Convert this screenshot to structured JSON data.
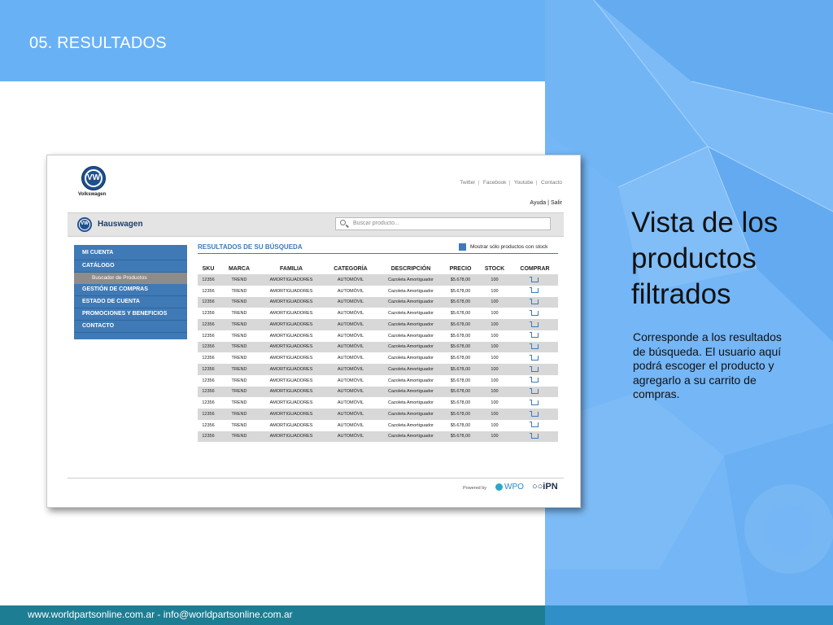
{
  "slide": {
    "title": "05. RESULTADOS",
    "heading": "Vista de los productos filtrados",
    "description": "Corresponde a los resultados de búsqueda. El usuario aquí podrá escoger el producto y agregarlo a su carrito de compras.",
    "footer": "www.worldpartsonline.com.ar - info@worldpartsonline.com.ar",
    "colors": {
      "band": "#69b1f5",
      "panel": "#74b6f6",
      "footer": "#1d7d93",
      "accent": "#3f7ab6"
    }
  },
  "app": {
    "brand": "Volkswagen",
    "links": [
      "Twitter",
      "Facebook",
      "Youtube",
      "Contacto"
    ],
    "help": "Ayuda",
    "logout": "Salir",
    "header_title": "Hauswagen",
    "logo_letters": "VW",
    "search": {
      "placeholder": "Buscar producto...",
      "icon": "search-icon"
    },
    "menu": {
      "items": [
        "MI CUENTA",
        "CATÁLOGO"
      ],
      "sub_item": "Buscador de Productos",
      "items_after": [
        "GESTIÓN DE COMPRAS",
        "ESTADO DE CUENTA",
        "PROMOCIONES Y BENEFICIOS",
        "CONTACTO"
      ]
    },
    "results_title": "RESULTADOS DE SU BÚSQUEDA",
    "stock_filter": {
      "label": "Mostrar sólo productos con stock",
      "checked": true
    },
    "table": {
      "headers": [
        "SKU",
        "MARCA",
        "FAMILIA",
        "CATEGORÍA",
        "DESCRIPCIÓN",
        "PRECIO",
        "STOCK",
        "COMPRAR"
      ],
      "rows": [
        [
          "12356",
          "TREND",
          "AMORTIGUADORES",
          "AUTOMÓVIL",
          "Cazoleta Amortiguador",
          "$5.678,00",
          "100"
        ],
        [
          "12356",
          "TREND",
          "AMORTIGUADORES",
          "AUTOMÓVIL",
          "Cazoleta Amortiguador",
          "$5.678,00",
          "100"
        ],
        [
          "12356",
          "TREND",
          "AMORTIGUADORES",
          "AUTOMÓVIL",
          "Cazoleta Amortiguador",
          "$5.678,00",
          "100"
        ],
        [
          "12356",
          "TREND",
          "AMORTIGUADORES",
          "AUTOMÓVIL",
          "Cazoleta Amortiguador",
          "$5.678,00",
          "100"
        ],
        [
          "12356",
          "TREND",
          "AMORTIGUADORES",
          "AUTOMÓVIL",
          "Cazoleta Amortiguador",
          "$5.678,00",
          "100"
        ],
        [
          "12356",
          "TREND",
          "AMORTIGUADORES",
          "AUTOMÓVIL",
          "Cazoleta Amortiguador",
          "$5.678,00",
          "100"
        ],
        [
          "12356",
          "TREND",
          "AMORTIGUADORES",
          "AUTOMÓVIL",
          "Cazoleta Amortiguador",
          "$5.678,00",
          "100"
        ],
        [
          "12356",
          "TREND",
          "AMORTIGUADORES",
          "AUTOMÓVIL",
          "Cazoleta Amortiguador",
          "$5.678,00",
          "100"
        ],
        [
          "12356",
          "TREND",
          "AMORTIGUADORES",
          "AUTOMÓVIL",
          "Cazoleta Amortiguador",
          "$5.678,00",
          "100"
        ],
        [
          "12356",
          "TREND",
          "AMORTIGUADORES",
          "AUTOMÓVIL",
          "Cazoleta Amortiguador",
          "$5.678,00",
          "100"
        ],
        [
          "12356",
          "TREND",
          "AMORTIGUADORES",
          "AUTOMÓVIL",
          "Cazoleta Amortiguador",
          "$5.678,00",
          "100"
        ],
        [
          "12356",
          "TREND",
          "AMORTIGUADORES",
          "AUTOMÓVIL",
          "Cazoleta Amortiguador",
          "$5.678,00",
          "100"
        ],
        [
          "12356",
          "TREND",
          "AMORTIGUADORES",
          "AUTOMÓVIL",
          "Cazoleta Amortiguador",
          "$5.678,00",
          "100"
        ],
        [
          "12356",
          "TREND",
          "AMORTIGUADORES",
          "AUTOMÓVIL",
          "Cazoleta Amortiguador",
          "$5.678,00",
          "100"
        ],
        [
          "12356",
          "TREND",
          "AMORTIGUADORES",
          "AUTOMÓVIL",
          "Cazoleta Amortiguador",
          "$5.678,00",
          "100"
        ]
      ],
      "row_action_icon": "cart-icon"
    },
    "footer": {
      "powered": "Powered by",
      "partner1": "WPO",
      "partner2": "iPN"
    }
  }
}
